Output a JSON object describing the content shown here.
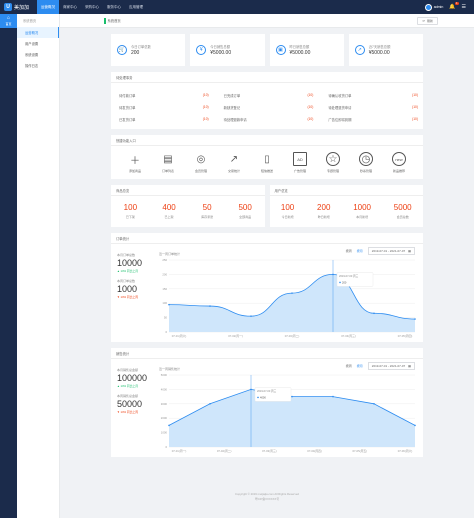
{
  "app": {
    "logo_mark": "U",
    "name": "美加加"
  },
  "topnav": [
    "运营概况",
    "商家中心",
    "采购中心",
    "服务中心",
    "应用管理"
  ],
  "user": {
    "name": "admin",
    "badge": "1"
  },
  "leftnav": {
    "home": "首页"
  },
  "subnav": {
    "header": "系统首页",
    "items": [
      "运营概况",
      "用户设置",
      "系统设置",
      "操作日志"
    ]
  },
  "tabbar": {
    "tab": "系统首页",
    "refresh": "刷新"
  },
  "kpis": [
    {
      "label": "今日订单总数",
      "value": "200",
      "icon": "cart-icon"
    },
    {
      "label": "今日销售总额",
      "value": "¥5000.00",
      "icon": "yen-icon"
    },
    {
      "label": "昨日销售总额",
      "value": "¥5000.00",
      "icon": "wallet-icon"
    },
    {
      "label": "近7天销售总额",
      "value": "¥5000.00",
      "icon": "trend-icon"
    }
  ],
  "todo": {
    "title": "待处理事务",
    "items": [
      {
        "label": "待付款订单",
        "count": "(10)"
      },
      {
        "label": "已完成订单",
        "count": "(10)"
      },
      {
        "label": "待确认收货订单",
        "count": "(10)"
      },
      {
        "label": "待发货订单",
        "count": "(10)"
      },
      {
        "label": "新缺货登记",
        "count": "(10)"
      },
      {
        "label": "待处理退货申请",
        "count": "(10)"
      },
      {
        "label": "已发货订单",
        "count": "(10)"
      },
      {
        "label": "待处理退款申请",
        "count": "(10)"
      },
      {
        "label": "广告位即将到期",
        "count": "(10)"
      }
    ]
  },
  "quick": {
    "title": "快捷功能入口",
    "items": [
      {
        "label": "添加商品",
        "icon": "add-icon"
      },
      {
        "label": "订单列表",
        "icon": "clipboard-icon"
      },
      {
        "label": "会员管理",
        "icon": "member-icon"
      },
      {
        "label": "交易统计",
        "icon": "chart-icon"
      },
      {
        "label": "短信推送",
        "icon": "phone-icon"
      },
      {
        "label": "广告管理",
        "icon": "ad-icon"
      },
      {
        "label": "专题管理",
        "icon": "star-icon"
      },
      {
        "label": "秒杀管理",
        "icon": "clock-icon"
      },
      {
        "label": "新品推荐",
        "icon": "new-icon"
      }
    ]
  },
  "goods": {
    "title": "商品总览",
    "stats": [
      {
        "value": "100",
        "label": "已下架"
      },
      {
        "value": "400",
        "label": "已上架"
      },
      {
        "value": "50",
        "label": "库存紧张"
      },
      {
        "value": "500",
        "label": "全部商品"
      }
    ]
  },
  "users": {
    "title": "用户总览",
    "stats": [
      {
        "value": "100",
        "label": "今日新增"
      },
      {
        "value": "200",
        "label": "昨日新增"
      },
      {
        "value": "1000",
        "label": "本月新增"
      },
      {
        "value": "5000",
        "label": "会员总数"
      }
    ]
  },
  "order_chart": {
    "title": "订单统计",
    "left": [
      {
        "label": "本月订单总数",
        "value": "10000",
        "change": "▲ 10% 同比上月"
      },
      {
        "label": "本周订单总数",
        "value": "1000",
        "change": "▼ 10% 同比上周"
      }
    ],
    "inner_title": "近一周订单统计",
    "filters": {
      "week": "按周",
      "month": "按月",
      "range": "2019-07-01 - 2021-07-07"
    },
    "tooltip": {
      "date": "2019-07-03 周三",
      "value": "200"
    }
  },
  "sales_chart": {
    "title": "销售统计",
    "left": [
      {
        "label": "本月销售总金额",
        "value": "100000",
        "change": "▲ 10% 同比上月"
      },
      {
        "label": "本周销售总金额",
        "value": "50000",
        "change": "▼ 10% 同比上周"
      }
    ],
    "inner_title": "近一周销售统计",
    "filters": {
      "week": "按周",
      "month": "按月",
      "range": "2019-07-01 - 2021-07-07"
    },
    "tooltip": {
      "date": "2019-07-03 周三",
      "value": "4000"
    }
  },
  "chart_data": [
    {
      "type": "area",
      "categories": [
        "07-01(周一)",
        "07-02(周二)",
        "07-03(周三)",
        "07-04(周四)",
        "07-05(周五)",
        "07-06(周六)",
        "07-07(周日)"
      ],
      "x_tick_labels": [
        "07-01(周六)",
        "07-02(周一)",
        "07-03(周二)",
        "07-04(周三)",
        "07-05(周四)"
      ],
      "values": [
        95,
        90,
        55,
        135,
        200,
        65,
        45
      ],
      "ylim": [
        0,
        250
      ],
      "yticks": [
        0,
        50,
        100,
        150,
        200,
        250
      ],
      "grid": true,
      "color": "#2d8cf0"
    },
    {
      "type": "area",
      "categories": [
        "07-01(周一)",
        "07-02(周二)",
        "07-03(周三)",
        "07-04(周四)",
        "07-05(周五)",
        "07-06(周六)",
        "07-07(周日)"
      ],
      "x_tick_labels": [
        "07-01(周一)",
        "07-02(周二)",
        "07-03(周三)",
        "07-04(周四)",
        "07-05(周五)",
        "07-06(周六)"
      ],
      "values": [
        1500,
        3000,
        4000,
        3500,
        3500,
        3000,
        1500
      ],
      "ylim": [
        0,
        5000
      ],
      "yticks": [
        0,
        1000,
        2000,
        3000,
        4000,
        5000
      ],
      "grid": true,
      "color": "#2d8cf0"
    }
  ],
  "footer": {
    "line1": "Copyright © 2019 meijiajia.com All Rights Reserved",
    "line2": "粤ICP备XXXXXX号"
  }
}
